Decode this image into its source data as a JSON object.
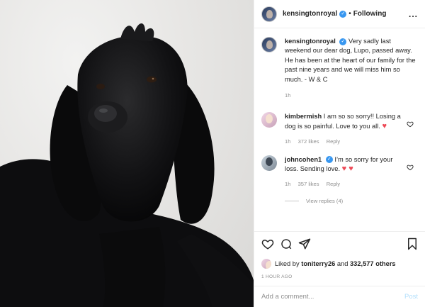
{
  "post": {
    "author": "kensingtonroyal",
    "separator": "•",
    "follow_status": "Following",
    "more_label": "...",
    "caption_author": "kensingtonroyal",
    "caption_text": "Very sadly last weekend our dear dog, Lupo, passed away. He has been at the heart of our family for the past nine years and we will miss him so much. - W & C",
    "caption_time": "1h"
  },
  "comments": [
    {
      "author": "kimbermish",
      "text": "I am so so sorry!! Losing a dog is so painful. Love to you all.",
      "emoji": "♥",
      "time": "1h",
      "likes": "372 likes",
      "reply": "Reply"
    },
    {
      "author": "johncohen1",
      "text": "I’m so sorry for your loss. Sending love.",
      "emoji": "♥ ♥",
      "time": "1h",
      "likes": "357 likes",
      "reply": "Reply"
    }
  ],
  "view_replies": "View replies (4)",
  "likes": {
    "prefix": "Liked by",
    "user": "toniterry26",
    "middle": "and",
    "count": "332,577 others"
  },
  "timestamp": "1 HOUR AGO",
  "add_comment": {
    "placeholder": "Add a comment...",
    "post_label": "Post"
  },
  "icons": [
    "heart-icon",
    "comment-icon",
    "share-icon",
    "bookmark-icon",
    "verified-icon"
  ],
  "colors": {
    "verified": "#3897f0",
    "heart": "#ed4956",
    "muted": "#8e8e8e",
    "post_disabled": "#b2dffc"
  }
}
